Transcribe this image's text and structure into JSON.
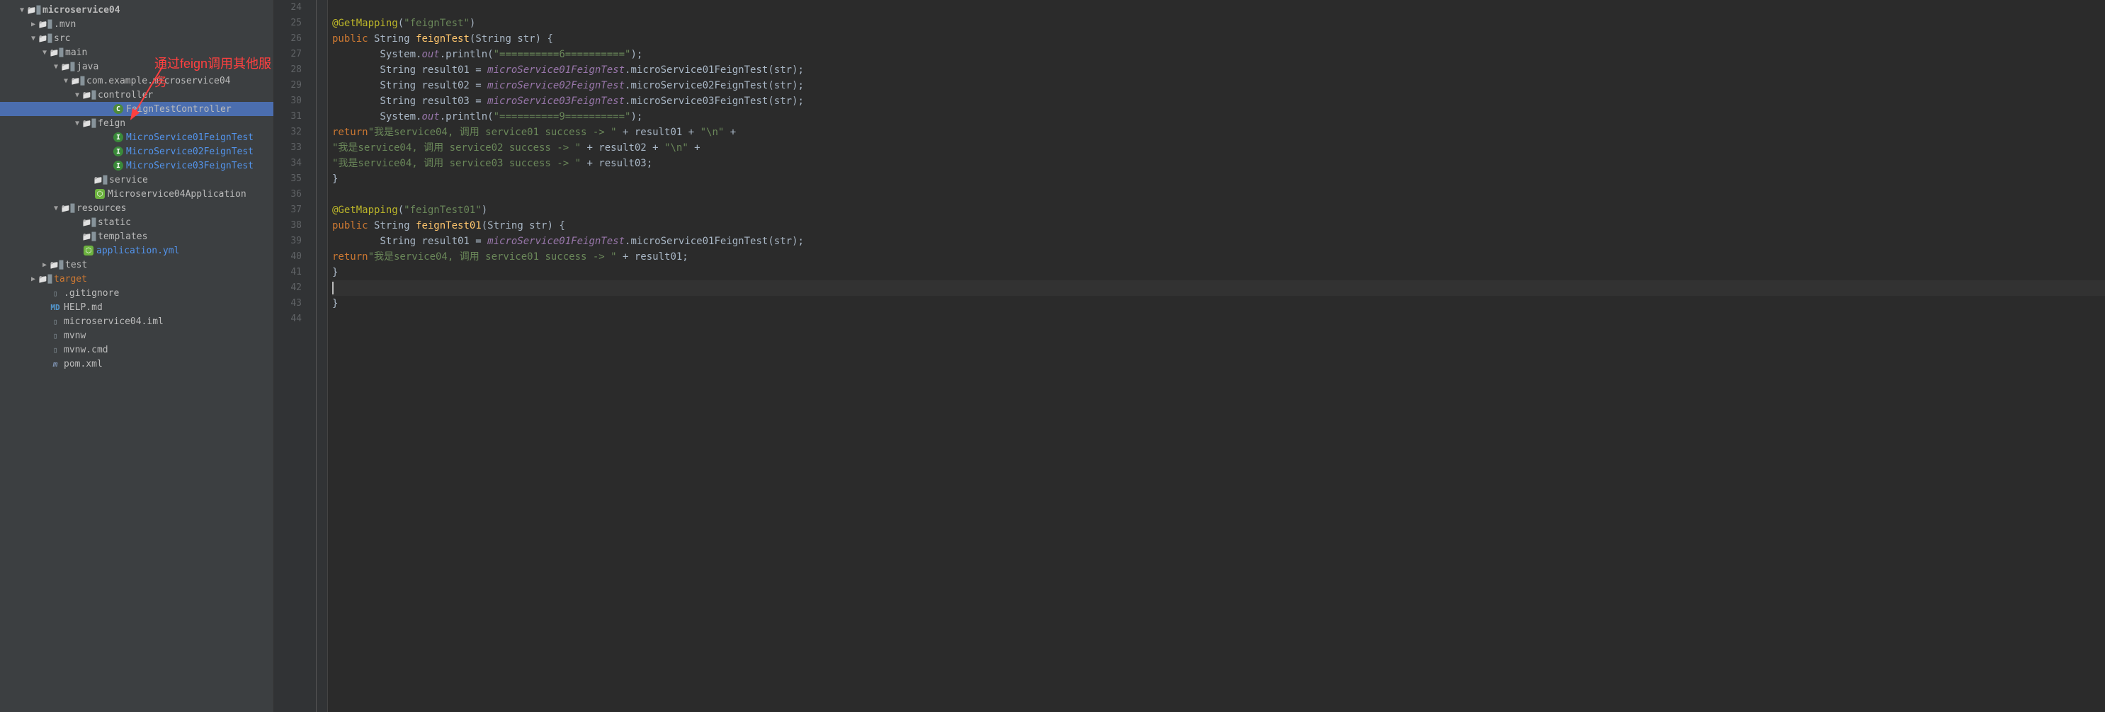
{
  "tree": {
    "root": "microservice04",
    "items": [
      {
        "indent": 28,
        "arrow": "down",
        "icon": "folder",
        "label": "microservice04",
        "bold": true,
        "module": true
      },
      {
        "indent": 44,
        "arrow": "right",
        "icon": "folder",
        "label": ".mvn"
      },
      {
        "indent": 44,
        "arrow": "down",
        "icon": "folder",
        "label": "src"
      },
      {
        "indent": 60,
        "arrow": "down",
        "icon": "folder",
        "label": "main"
      },
      {
        "indent": 76,
        "arrow": "down",
        "icon": "folder",
        "label": "java"
      },
      {
        "indent": 90,
        "arrow": "down",
        "icon": "pkg",
        "label": "com.example.microservice04"
      },
      {
        "indent": 106,
        "arrow": "down",
        "icon": "pkg",
        "label": "controller"
      },
      {
        "indent": 148,
        "arrow": "",
        "icon": "class-c",
        "label": "FeignTestController",
        "selected": true
      },
      {
        "indent": 106,
        "arrow": "down",
        "icon": "pkg",
        "label": "feign"
      },
      {
        "indent": 148,
        "arrow": "",
        "icon": "interface-i",
        "label": "MicroService01FeignTest",
        "blue": true
      },
      {
        "indent": 148,
        "arrow": "",
        "icon": "interface-i",
        "label": "MicroService02FeignTest",
        "blue": true
      },
      {
        "indent": 148,
        "arrow": "",
        "icon": "interface-i",
        "label": "MicroService03FeignTest",
        "blue": true
      },
      {
        "indent": 122,
        "arrow": "",
        "icon": "pkg",
        "label": "service"
      },
      {
        "indent": 122,
        "arrow": "",
        "icon": "spring",
        "label": "Microservice04Application"
      },
      {
        "indent": 76,
        "arrow": "down",
        "icon": "folder",
        "label": "resources"
      },
      {
        "indent": 106,
        "arrow": "",
        "icon": "folder",
        "label": "static"
      },
      {
        "indent": 106,
        "arrow": "",
        "icon": "folder",
        "label": "templates"
      },
      {
        "indent": 106,
        "arrow": "",
        "icon": "spring",
        "label": "application.yml",
        "blue": true
      },
      {
        "indent": 60,
        "arrow": "right",
        "icon": "folder",
        "label": "test"
      },
      {
        "indent": 44,
        "arrow": "right",
        "icon": "folder",
        "label": "target",
        "orange": true
      },
      {
        "indent": 58,
        "arrow": "",
        "icon": "file",
        "label": ".gitignore"
      },
      {
        "indent": 58,
        "arrow": "",
        "icon": "md",
        "label": "HELP.md"
      },
      {
        "indent": 58,
        "arrow": "",
        "icon": "file",
        "label": "microservice04.iml"
      },
      {
        "indent": 58,
        "arrow": "",
        "icon": "file",
        "label": "mvnw"
      },
      {
        "indent": 58,
        "arrow": "",
        "icon": "file",
        "label": "mvnw.cmd"
      },
      {
        "indent": 58,
        "arrow": "",
        "icon": "m",
        "label": "pom.xml"
      }
    ]
  },
  "annotation": "通过feign调用其他服务",
  "gutter": {
    "start": 24,
    "end": 44
  },
  "code": [
    {
      "n": 24,
      "html": ""
    },
    {
      "n": 25,
      "html": "    <span class='ann'>@GetMapping</span><span class='paren'>(</span><span class='str'>\"feignTest\"</span><span class='paren'>)</span>"
    },
    {
      "n": 26,
      "html": "    <span class='kw'>public</span> String <span class='method'>feignTest</span><span class='paren'>(</span>String str<span class='paren'>) {</span>"
    },
    {
      "n": 27,
      "html": "        System.<span class='field'>out</span>.println<span class='paren'>(</span><span class='str'>\"==========6==========\"</span><span class='paren'>);</span>"
    },
    {
      "n": 28,
      "html": "        String result01 = <span class='field'>microService01FeignTest</span>.microService01FeignTest<span class='paren'>(</span>str<span class='paren'>);</span>"
    },
    {
      "n": 29,
      "html": "        String result02 = <span class='field'>microService02FeignTest</span>.microService02FeignTest<span class='paren'>(</span>str<span class='paren'>);</span>"
    },
    {
      "n": 30,
      "html": "        String result03 = <span class='field'>microService03FeignTest</span>.microService03FeignTest<span class='paren'>(</span>str<span class='paren'>);</span>"
    },
    {
      "n": 31,
      "html": "        System.<span class='field'>out</span>.println<span class='paren'>(</span><span class='str'>\"==========9==========\"</span><span class='paren'>);</span>"
    },
    {
      "n": 32,
      "html": "        <span class='kw'>return</span> <span class='str'>\"我是service04, 调用 service01 success -> \"</span> + result01 + <span class='str'>\"\\n\"</span> +"
    },
    {
      "n": 33,
      "html": "               <span class='str'>\"我是service04, 调用 service02 success -> \"</span> + result02 + <span class='str'>\"\\n\"</span> +"
    },
    {
      "n": 34,
      "html": "               <span class='str'>\"我是service04, 调用 service03 success -> \"</span> + result03;"
    },
    {
      "n": 35,
      "html": "    <span class='paren'>}</span>"
    },
    {
      "n": 36,
      "html": ""
    },
    {
      "n": 37,
      "html": "    <span class='ann'>@GetMapping</span><span class='paren'>(</span><span class='str'>\"feignTest01\"</span><span class='paren'>)</span>"
    },
    {
      "n": 38,
      "html": "    <span class='kw'>public</span> String <span class='method'>feignTest01</span><span class='paren'>(</span>String str<span class='paren'>) {</span>"
    },
    {
      "n": 39,
      "html": "        String result01 = <span class='field'>microService01FeignTest</span>.microService01FeignTest<span class='paren'>(</span>str<span class='paren'>);</span>"
    },
    {
      "n": 40,
      "html": "        <span class='kw'>return</span> <span class='str'>\"我是service04, 调用 service01 success -> \"</span> + result01;"
    },
    {
      "n": 41,
      "html": "    <span class='paren'>}</span>"
    },
    {
      "n": 42,
      "html": "<span class='caret'></span>",
      "current": true
    },
    {
      "n": 43,
      "html": "<span class='paren'>}</span>"
    },
    {
      "n": 44,
      "html": ""
    }
  ]
}
